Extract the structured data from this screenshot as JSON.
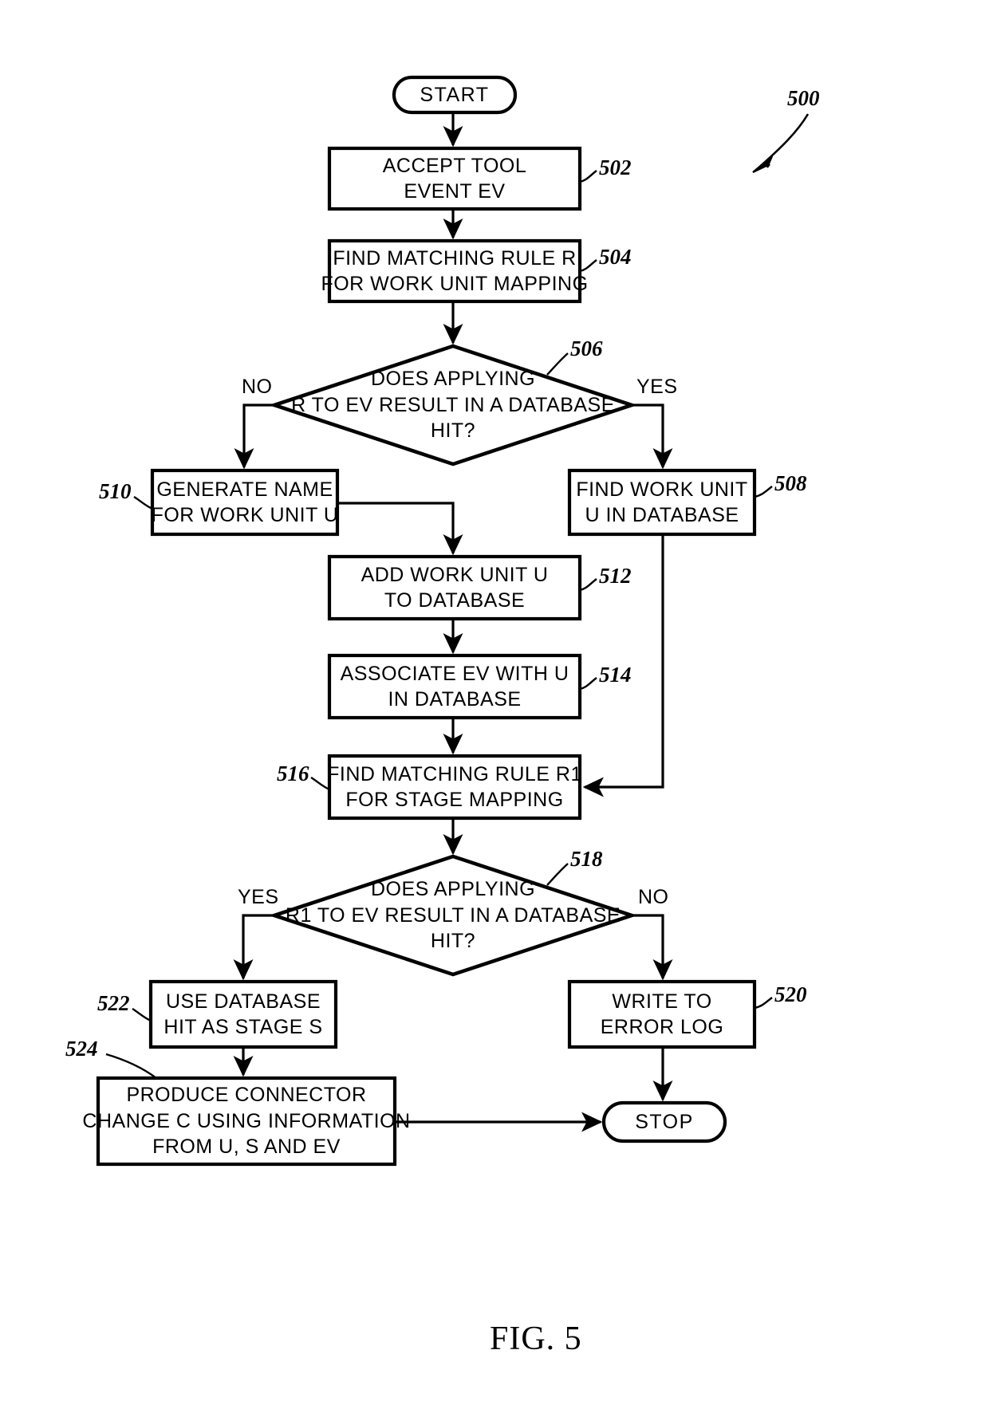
{
  "figure": {
    "caption": "FIG. 5",
    "diagram_ref": "500"
  },
  "diagram": {
    "type": "flowchart",
    "title": "Method of processing a tool event into a connector change",
    "nodes": [
      {
        "id": "start",
        "shape": "terminator",
        "ref": "",
        "lines": [
          "START"
        ]
      },
      {
        "id": "n502",
        "shape": "process",
        "ref": "502",
        "lines": [
          "ACCEPT TOOL",
          "EVENT EV"
        ]
      },
      {
        "id": "n504",
        "shape": "process",
        "ref": "504",
        "lines": [
          "FIND MATCHING RULE R",
          "FOR WORK UNIT MAPPING"
        ]
      },
      {
        "id": "n506",
        "shape": "decision",
        "ref": "506",
        "lines": [
          "DOES APPLYING",
          "R TO EV RESULT IN A DATABASE",
          "HIT?"
        ],
        "branch_left": "NO",
        "branch_right": "YES"
      },
      {
        "id": "n510",
        "shape": "process",
        "ref": "510",
        "lines": [
          "GENERATE NAME",
          "FOR WORK UNIT U"
        ]
      },
      {
        "id": "n508",
        "shape": "process",
        "ref": "508",
        "lines": [
          "FIND WORK UNIT",
          "U IN DATABASE"
        ]
      },
      {
        "id": "n512",
        "shape": "process",
        "ref": "512",
        "lines": [
          "ADD WORK UNIT U",
          "TO DATABASE"
        ]
      },
      {
        "id": "n514",
        "shape": "process",
        "ref": "514",
        "lines": [
          "ASSOCIATE EV WITH U",
          "IN DATABASE"
        ]
      },
      {
        "id": "n516",
        "shape": "process",
        "ref": "516",
        "lines": [
          "FIND MATCHING RULE R1",
          "FOR STAGE MAPPING"
        ]
      },
      {
        "id": "n518",
        "shape": "decision",
        "ref": "518",
        "lines": [
          "DOES APPLYING",
          "R1 TO EV RESULT IN A DATABASE",
          "HIT?"
        ],
        "branch_left": "YES",
        "branch_right": "NO"
      },
      {
        "id": "n522",
        "shape": "process",
        "ref": "522",
        "lines": [
          "USE DATABASE",
          "HIT AS STAGE S"
        ]
      },
      {
        "id": "n520",
        "shape": "process",
        "ref": "520",
        "lines": [
          "WRITE TO",
          "ERROR LOG"
        ]
      },
      {
        "id": "n524",
        "shape": "process",
        "ref": "524",
        "lines": [
          "PRODUCE CONNECTOR",
          "CHANGE C USING INFORMATION",
          "FROM U, S AND EV"
        ]
      },
      {
        "id": "stop",
        "shape": "terminator",
        "ref": "",
        "lines": [
          "STOP"
        ]
      }
    ],
    "edges": [
      {
        "from": "start",
        "to": "n502",
        "label": ""
      },
      {
        "from": "n502",
        "to": "n504",
        "label": ""
      },
      {
        "from": "n504",
        "to": "n506",
        "label": ""
      },
      {
        "from": "n506",
        "to": "n510",
        "label": "NO"
      },
      {
        "from": "n506",
        "to": "n508",
        "label": "YES"
      },
      {
        "from": "n510",
        "to": "n512",
        "label": ""
      },
      {
        "from": "n512",
        "to": "n514",
        "label": ""
      },
      {
        "from": "n514",
        "to": "n516",
        "label": ""
      },
      {
        "from": "n508",
        "to": "n516",
        "label": ""
      },
      {
        "from": "n516",
        "to": "n518",
        "label": ""
      },
      {
        "from": "n518",
        "to": "n522",
        "label": "YES"
      },
      {
        "from": "n518",
        "to": "n520",
        "label": "NO"
      },
      {
        "from": "n522",
        "to": "n524",
        "label": ""
      },
      {
        "from": "n524",
        "to": "stop",
        "label": ""
      },
      {
        "from": "n520",
        "to": "stop",
        "label": ""
      }
    ]
  },
  "labels": {
    "start": "START",
    "stop": "STOP",
    "n502_l1": "ACCEPT TOOL",
    "n502_l2": "EVENT EV",
    "n504_l1": "FIND MATCHING RULE R",
    "n504_l2": "FOR WORK UNIT MAPPING",
    "n506_l1": "DOES APPLYING",
    "n506_l2": "R TO EV RESULT IN A DATABASE",
    "n506_l3": "HIT?",
    "n510_l1": "GENERATE NAME",
    "n510_l2": "FOR WORK UNIT U",
    "n508_l1": "FIND WORK UNIT",
    "n508_l2": "U IN DATABASE",
    "n512_l1": "ADD WORK UNIT U",
    "n512_l2": "TO DATABASE",
    "n514_l1": "ASSOCIATE EV WITH U",
    "n514_l2": "IN DATABASE",
    "n516_l1": "FIND MATCHING RULE R1",
    "n516_l2": "FOR STAGE MAPPING",
    "n518_l1": "DOES APPLYING",
    "n518_l2": "R1 TO EV RESULT IN A DATABASE",
    "n518_l3": "HIT?",
    "n522_l1": "USE DATABASE",
    "n522_l2": "HIT AS STAGE S",
    "n520_l1": "WRITE TO",
    "n520_l2": "ERROR LOG",
    "n524_l1": "PRODUCE CONNECTOR",
    "n524_l2": "CHANGE C USING INFORMATION",
    "n524_l3": "FROM U, S AND EV"
  },
  "refs": {
    "r500": "500",
    "r502": "502",
    "r504": "504",
    "r506": "506",
    "r508": "508",
    "r510": "510",
    "r512": "512",
    "r514": "514",
    "r516": "516",
    "r518": "518",
    "r520": "520",
    "r522": "522",
    "r524": "524"
  },
  "branches": {
    "d506_no": "NO",
    "d506_yes": "YES",
    "d518_yes": "YES",
    "d518_no": "NO"
  },
  "colors": {
    "ink": "#000000",
    "paper": "#ffffff"
  }
}
